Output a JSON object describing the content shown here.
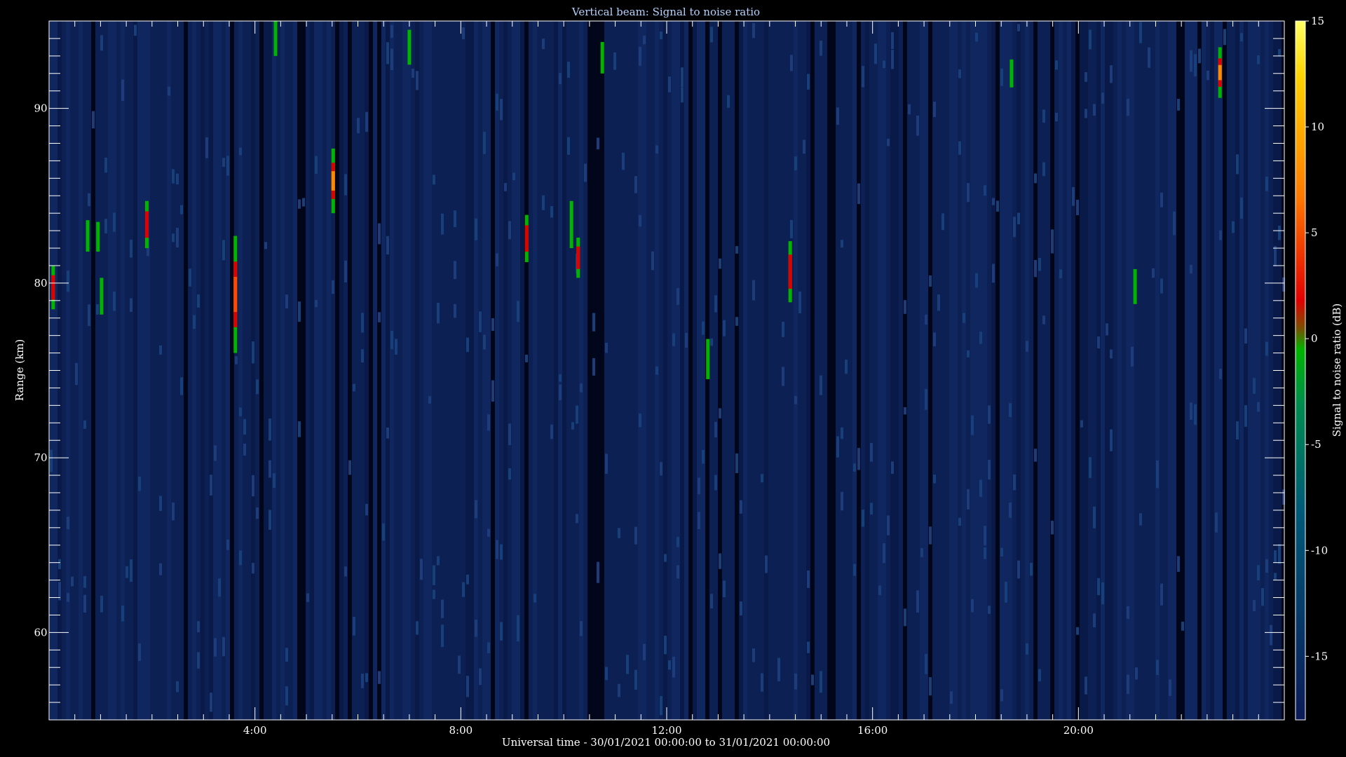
{
  "chart_data": {
    "type": "heatmap",
    "title": "Vertical beam: Signal to noise ratio",
    "xlabel": "Universal time - 30/01/2021 00:00:00 to 31/01/2021 00:00:00",
    "ylabel": "Range (km)",
    "xlim_hours": [
      0,
      24
    ],
    "ylim_km": [
      55,
      95
    ],
    "x_tick_labels": [
      "4:00",
      "8:00",
      "12:00",
      "16:00",
      "20:00"
    ],
    "y_tick_labels": [
      "60",
      "70",
      "80",
      "90"
    ],
    "colorbar": {
      "label": "Signal to noise ratio (dB)",
      "range_db": [
        -18,
        15
      ],
      "tick_labels": [
        "15",
        "10",
        "5",
        "0",
        "-5",
        "-10",
        "-15"
      ],
      "colors": [
        "#1e2a6e",
        "#005a78",
        "#008c50",
        "#00b400",
        "#e10000",
        "#ff7a00",
        "#ffe600",
        "#ffff64"
      ]
    },
    "background_color": "#0c1e50",
    "echoes": [
      {
        "time_h": 0.08,
        "range_low_km": 78.5,
        "range_high_km": 81.0,
        "peak_db": 3
      },
      {
        "time_h": 0.75,
        "range_low_km": 81.8,
        "range_high_km": 83.6,
        "peak_db": -4
      },
      {
        "time_h": 0.95,
        "range_low_km": 81.8,
        "range_high_km": 83.5,
        "peak_db": -6
      },
      {
        "time_h": 1.02,
        "range_low_km": 78.2,
        "range_high_km": 80.3,
        "peak_db": -5
      },
      {
        "time_h": 1.9,
        "range_low_km": 82.0,
        "range_high_km": 84.7,
        "peak_db": 2
      },
      {
        "time_h": 3.62,
        "range_low_km": 76.0,
        "range_high_km": 82.7,
        "peak_db": 5
      },
      {
        "time_h": 4.4,
        "range_low_km": 93.0,
        "range_high_km": 95.0,
        "peak_db": -4
      },
      {
        "time_h": 5.52,
        "range_low_km": 84.0,
        "range_high_km": 87.7,
        "peak_db": 7
      },
      {
        "time_h": 7.0,
        "range_low_km": 92.5,
        "range_high_km": 94.5,
        "peak_db": -5
      },
      {
        "time_h": 9.28,
        "range_low_km": 81.2,
        "range_high_km": 83.9,
        "peak_db": 2
      },
      {
        "time_h": 10.15,
        "range_low_km": 82.0,
        "range_high_km": 84.7,
        "peak_db": -5
      },
      {
        "time_h": 10.28,
        "range_low_km": 80.3,
        "range_high_km": 82.6,
        "peak_db": 2
      },
      {
        "time_h": 10.75,
        "range_low_km": 92.0,
        "range_high_km": 93.8,
        "peak_db": -6
      },
      {
        "time_h": 12.8,
        "range_low_km": 74.5,
        "range_high_km": 76.8,
        "peak_db": -4
      },
      {
        "time_h": 14.4,
        "range_low_km": 78.9,
        "range_high_km": 82.4,
        "peak_db": 3
      },
      {
        "time_h": 18.7,
        "range_low_km": 91.2,
        "range_high_km": 92.8,
        "peak_db": -6
      },
      {
        "time_h": 21.1,
        "range_low_km": 78.8,
        "range_high_km": 80.8,
        "peak_db": -4
      },
      {
        "time_h": 22.75,
        "range_low_km": 90.6,
        "range_high_km": 93.5,
        "peak_db": 7
      }
    ]
  }
}
